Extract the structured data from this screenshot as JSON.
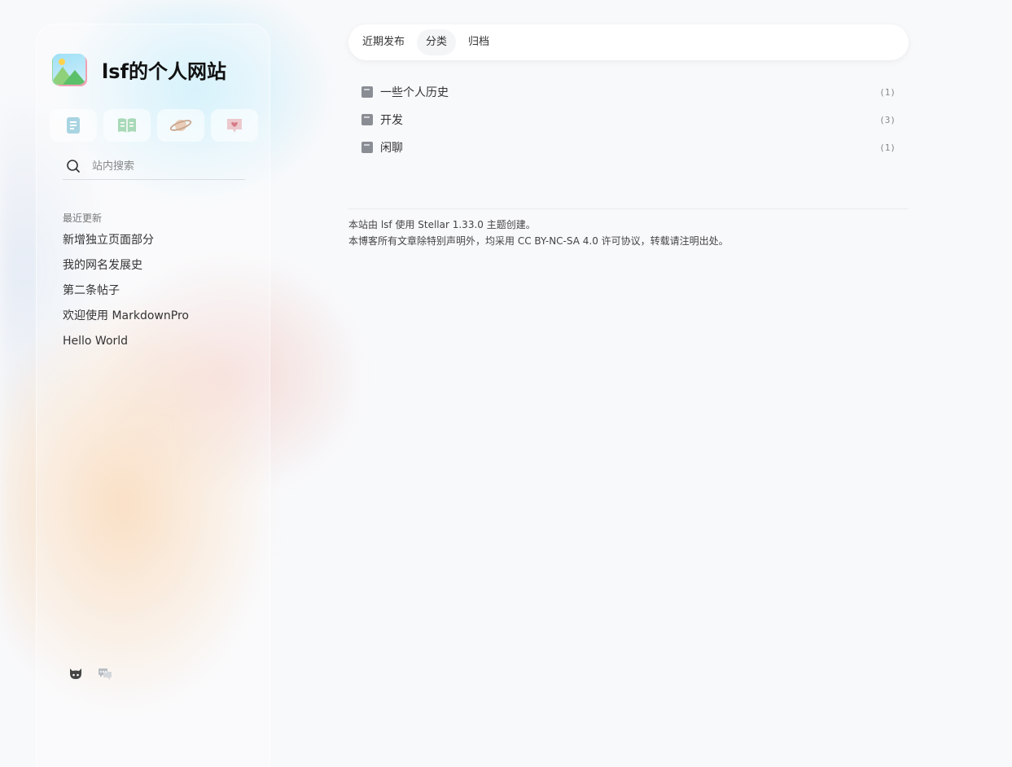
{
  "sidebar": {
    "site_title": "lsf的个人网站",
    "nav_icons": [
      "notes-icon",
      "book-icon",
      "planet-icon",
      "chat-heart-icon"
    ],
    "search_placeholder": "站内搜索",
    "recent_heading": "最近更新",
    "recent_items": [
      {
        "label": "新增独立页面部分"
      },
      {
        "label": "我的网名发展史"
      },
      {
        "label": "第二条帖子"
      },
      {
        "label": "欢迎使用 MarkdownPro"
      },
      {
        "label": "Hello World"
      }
    ],
    "social_icons": [
      "github-icon",
      "comments-icon"
    ]
  },
  "topnav": {
    "tabs": [
      {
        "label": "近期发布",
        "active": false
      },
      {
        "label": "分类",
        "active": true
      },
      {
        "label": "归档",
        "active": false
      }
    ]
  },
  "categories": [
    {
      "name": "一些个人历史",
      "count": "(1)"
    },
    {
      "name": "开发",
      "count": "(3)"
    },
    {
      "name": "闲聊",
      "count": "(1)"
    }
  ],
  "footer": {
    "line1": "本站由 lsf 使用 Stellar 1.33.0 主题创建。",
    "line2": "本博客所有文章除特别声明外，均采用 CC BY-NC-SA 4.0 许可协议，转载请注明出处。"
  },
  "colors": {
    "page_bg": "#f8f9fb",
    "category_icon": "#8a8e94",
    "active_tab_bg": "#f4f5f7"
  }
}
